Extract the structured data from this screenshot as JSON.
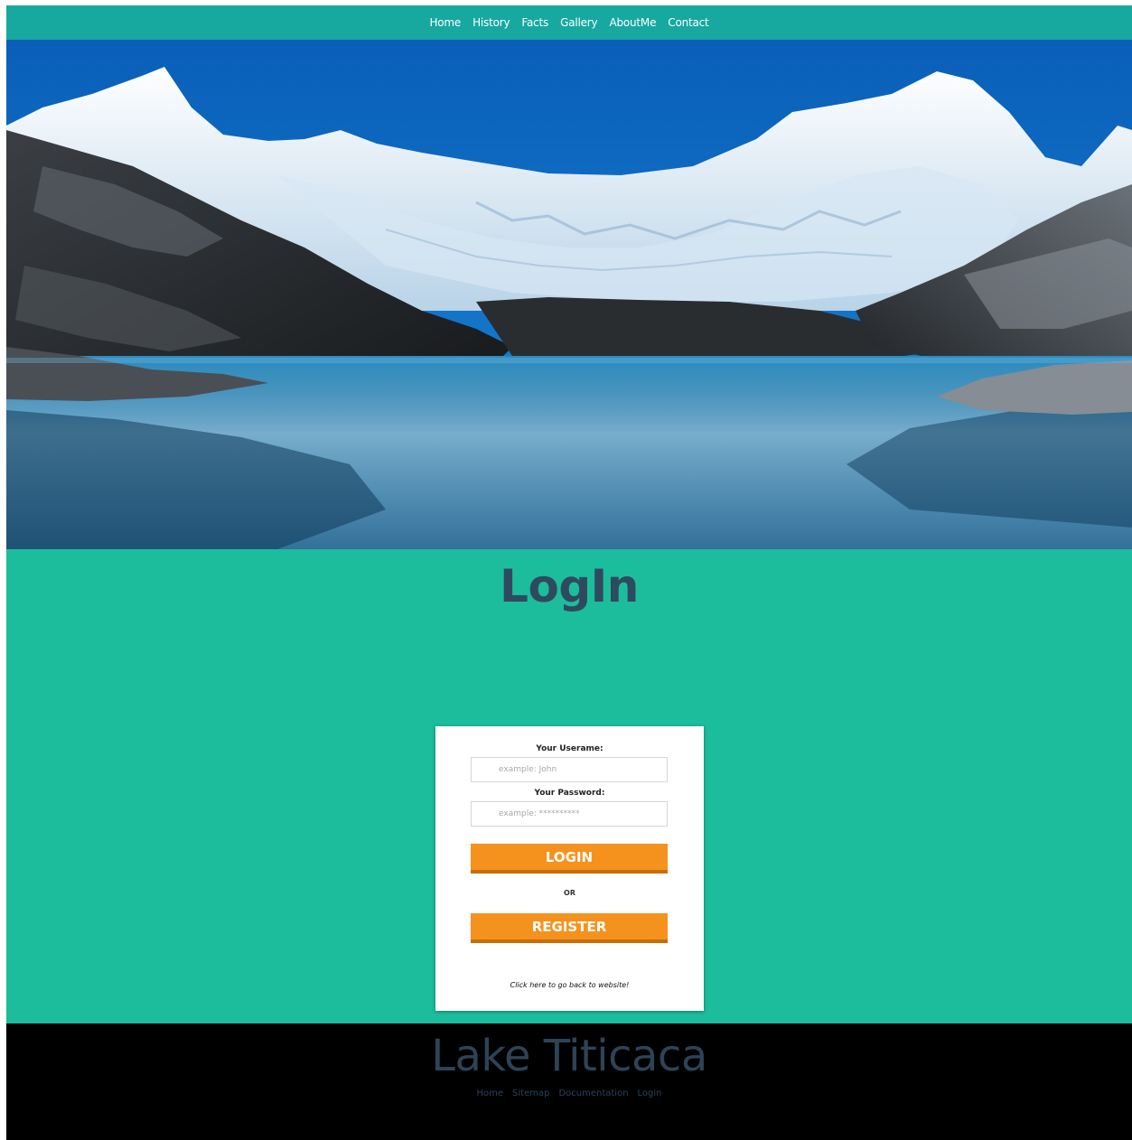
{
  "nav": {
    "items": [
      "Home",
      "History",
      "Facts",
      "Gallery",
      "AboutMe",
      "Contact"
    ]
  },
  "hero": {
    "description_icon": "mountain-lake-photo"
  },
  "login": {
    "title": "LogIn",
    "username_label": "Your Userame:",
    "username_placeholder": "example: John",
    "password_label": "Your Password:",
    "password_placeholder": "example: **********",
    "login_button": "LOGIN",
    "or_text": "OR",
    "register_button": "REGISTER",
    "back_link": "Click here to go back to website!"
  },
  "footer": {
    "title": "Lake Titicaca",
    "links": [
      "Home",
      "Sitemap",
      "Documentation",
      "Login"
    ]
  },
  "colors": {
    "nav_bg": "#17a8a0",
    "section_bg": "#1bbd9c",
    "title_color": "#2f4a5e",
    "button": "#f5921e",
    "button_shadow": "#c86d06",
    "footer_bg": "#000000",
    "footer_text": "#2d4357"
  }
}
